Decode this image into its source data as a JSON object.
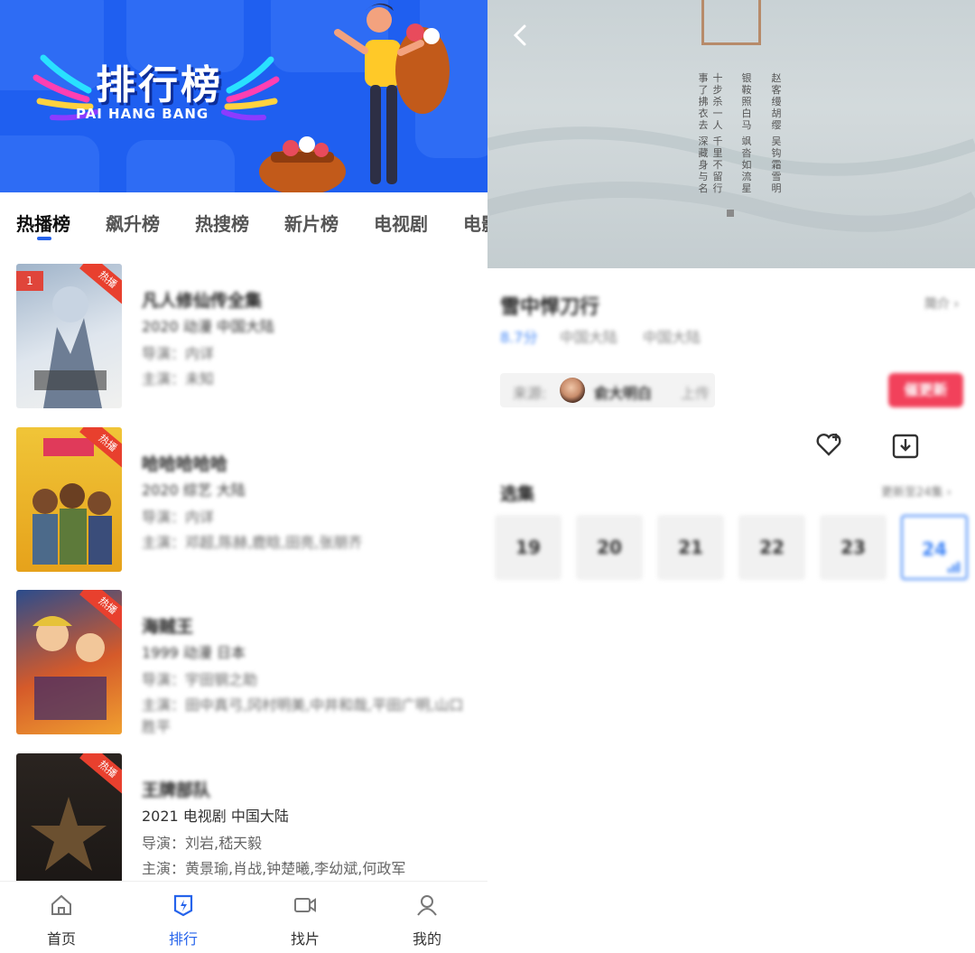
{
  "left": {
    "banner": {
      "title": "排行榜",
      "subtitle": "PAI HANG BANG"
    },
    "tabs": [
      "热播榜",
      "飙升榜",
      "热搜榜",
      "新片榜",
      "电视剧",
      "电影"
    ],
    "hot_tag": "热播",
    "items": [
      {
        "rank": "1",
        "title": "凡人修仙传全集",
        "meta": "2020  动漫  中国大陆",
        "director": "导演：内详",
        "cast": "主演：未知",
        "poster_colors": [
          "#9fb3c9",
          "#f1f1ef"
        ]
      },
      {
        "rank": "",
        "title": "哈哈哈哈哈",
        "meta": "2020  综艺  大陆",
        "director": "导演：内详",
        "cast": "主演：邓超,陈赫,鹿晗,田亮,张朋齐",
        "poster_colors": [
          "#e6a21b",
          "#f0c538"
        ]
      },
      {
        "rank": "",
        "title": "海贼王",
        "meta": "1999  动漫  日本",
        "director": "导演：宇田钢之助",
        "cast": "主演：田中真弓,冈村明美,中井和哉,平田广明,山口胜平",
        "poster_colors": [
          "#2b4c8c",
          "#d55a2a"
        ]
      },
      {
        "rank": "",
        "title": "王牌部队",
        "meta": "2021  电视剧  中国大陆",
        "director": "导演：刘岩,嵇天毅",
        "cast": "主演：黄景瑜,肖战,钟楚曦,李幼斌,何政军",
        "poster_colors": [
          "#1a1614",
          "#6b5030"
        ]
      }
    ],
    "tabbar": [
      {
        "label": "首页",
        "icon": "home-icon"
      },
      {
        "label": "排行",
        "icon": "ranking-icon"
      },
      {
        "label": "找片",
        "icon": "video-camera-icon"
      },
      {
        "label": "我的",
        "icon": "user-icon"
      }
    ]
  },
  "right": {
    "video": {
      "poem_columns": [
        "赵客缦胡缨",
        "吴钩霜雪明",
        "银鞍照白马",
        "飒沓如流星",
        "十步杀一人",
        "千里不留行",
        "事了拂衣去",
        "深藏身与名"
      ]
    },
    "title": "雪中悍刀行",
    "intro": "简介",
    "score": "8.7分",
    "region": "中国大陆",
    "region2": "中国大陆",
    "source": {
      "label": "来源:",
      "name": "俞大明白",
      "action": "上传"
    },
    "remind_button": "催更新",
    "episodes_label": "选集",
    "update_status": "更新至24集",
    "episodes": [
      "19",
      "20",
      "21",
      "22",
      "23",
      "24"
    ],
    "current_episode": "24"
  },
  "colors": {
    "accent": "#2563eb",
    "brand_red": "#f2415b",
    "banner_blue": "#1f5ff0"
  }
}
